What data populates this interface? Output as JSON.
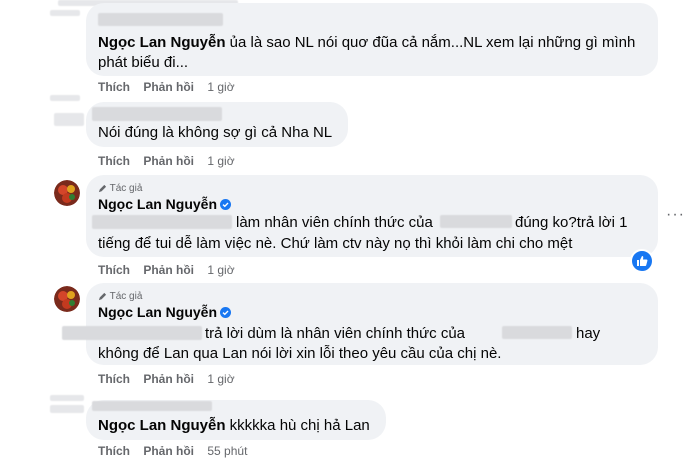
{
  "comments": [
    {
      "author": "Ngọc Lan Nguyễn",
      "text_line1": " ủa là sao NL nói quơ đũa cả nắm...NL xem lại những gì mình",
      "text_line2": "phát biểu đi...",
      "like_label": "Thích",
      "reply_label": "Phản hồi",
      "time": "1 giờ"
    },
    {
      "text_line1": "Nói đúng là không sợ gì cả Nha NL",
      "like_label": "Thích",
      "reply_label": "Phản hồi",
      "time": "1 giờ"
    },
    {
      "author_tag": "Tác giả",
      "author": "Ngọc Lan Nguyễn",
      "text_line1_a": "làm nhân viên chính thức của",
      "text_line1_b": "đúng ko?trả lời 1",
      "text_line2": "tiếng để tui dễ làm việc nè. Chứ làm ctv này nọ thì khỏi làm chi cho mệt",
      "like_label": "Thích",
      "reply_label": "Phản hồi",
      "time": "1 giờ"
    },
    {
      "author_tag": "Tác giả",
      "author": "Ngọc Lan Nguyễn",
      "text_line1_a": "trả lời dùm là nhân viên chính thức của",
      "text_line1_b": "hay",
      "text_line2": "không để Lan qua Lan nói lời xin lỗi theo yêu cầu của chị nè.",
      "like_label": "Thích",
      "reply_label": "Phản hồi",
      "time": "1 giờ"
    },
    {
      "author": "Ngọc Lan Nguyễn",
      "text_line1": " kkkkka hù chị hả Lan",
      "like_label": "Thích",
      "reply_label": "Phản hồi",
      "time": "55 phút"
    }
  ],
  "more_options": "···",
  "icons": {
    "more": "more-options-icon",
    "verified": "verified-badge-icon",
    "pencil": "pencil-icon",
    "like": "like-reaction-icon"
  },
  "colors": {
    "bubble": "#f0f2f5",
    "meta": "#65676b",
    "accent": "#1877f2"
  }
}
